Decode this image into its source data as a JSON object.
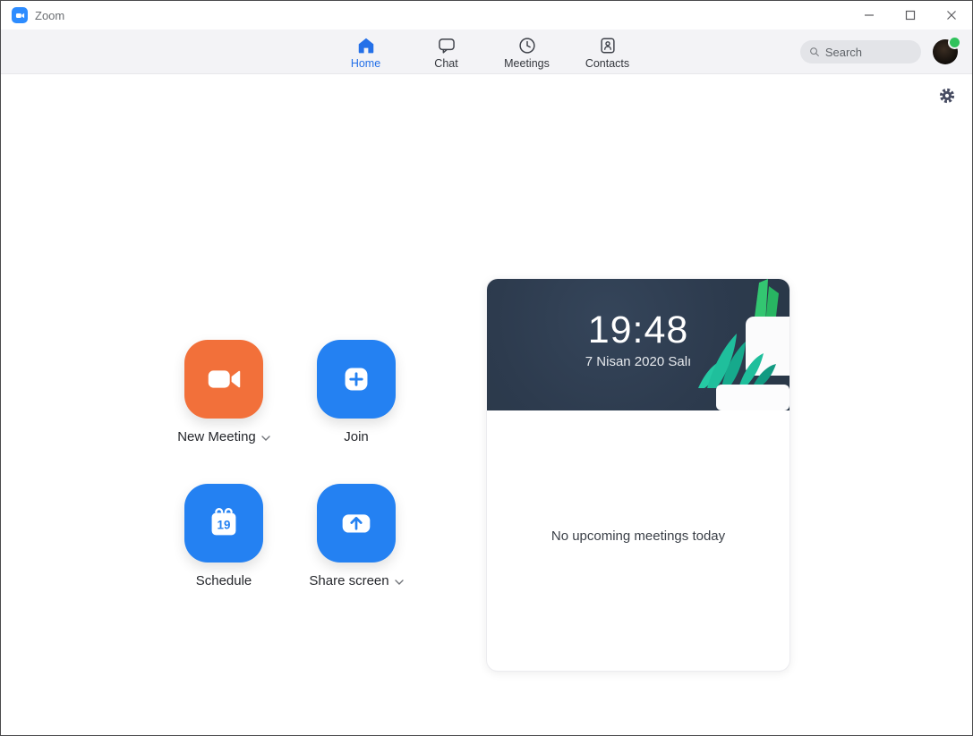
{
  "window": {
    "title": "Zoom",
    "controls": [
      {
        "name": "minimize",
        "icon": "minimize-icon"
      },
      {
        "name": "maximize",
        "icon": "maximize-icon"
      },
      {
        "name": "close",
        "icon": "close-icon"
      }
    ]
  },
  "nav": {
    "tabs": [
      {
        "label": "Home",
        "icon": "home-icon",
        "active": true
      },
      {
        "label": "Chat",
        "icon": "chat-bubble-icon",
        "active": false
      },
      {
        "label": "Meetings",
        "icon": "clock-icon",
        "active": false
      },
      {
        "label": "Contacts",
        "icon": "contact-card-icon",
        "active": false
      }
    ],
    "search": {
      "placeholder": "Search",
      "icon": "search-icon"
    },
    "avatar": {
      "status": "online"
    }
  },
  "toolbar": {
    "settings_icon": "gear-icon"
  },
  "actions": [
    {
      "label": "New Meeting",
      "icon": "video-camera-icon",
      "has_dropdown": true,
      "color": "#f2703a"
    },
    {
      "label": "Join",
      "icon": "plus-icon",
      "has_dropdown": false,
      "color": "#2481f2"
    },
    {
      "label": "Schedule",
      "icon": "calendar-icon",
      "has_dropdown": false,
      "color": "#2481f2",
      "calendar_day": "19"
    },
    {
      "label": "Share screen",
      "icon": "share-arrow-icon",
      "has_dropdown": true,
      "color": "#2481f2"
    }
  ],
  "meetings_card": {
    "time": "19:48",
    "date": "7 Nisan 2020 Salı",
    "empty_message": "No upcoming meetings today",
    "illustration": "potted-plants"
  },
  "colors": {
    "brand_blue": "#2d8cff",
    "button_blue": "#2481f2",
    "active_tab_blue": "#2470e8",
    "new_meeting_orange": "#f2703a",
    "header_navy": "#2d3b4e",
    "online_green": "#2fc25b",
    "leaf_green": "#33c671",
    "leaf_teal": "#1fbf9c",
    "navbar_gray": "#f3f3f6"
  }
}
